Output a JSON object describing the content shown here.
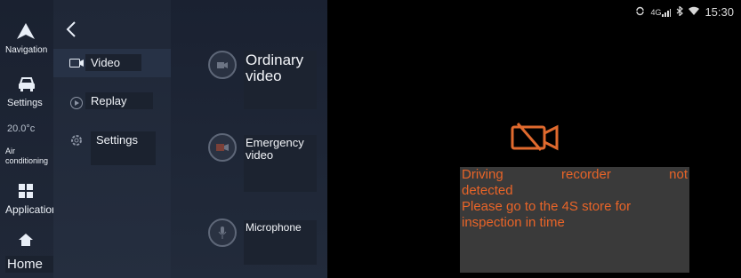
{
  "dock": {
    "items": [
      {
        "label": "Navigation",
        "icon": "navigation-arrow-icon"
      },
      {
        "label": "Settings",
        "icon": "car-icon"
      },
      {
        "label": "Air conditioning",
        "temperature": "20.0°c",
        "icon": "temperature-display"
      },
      {
        "label": "Applications",
        "icon": "grid-icon"
      },
      {
        "label": "Home",
        "icon": "home-icon"
      }
    ]
  },
  "menu": {
    "back_icon": "chevron-left-icon",
    "items": [
      {
        "label": "Video",
        "icon": "video-icon",
        "active": true
      },
      {
        "label": "Replay",
        "icon": "replay-icon",
        "active": false
      },
      {
        "label": "Settings",
        "icon": "gear-icon",
        "active": false
      }
    ]
  },
  "video_panel": {
    "ordinary": {
      "label": "Ordinary video",
      "icon": "video-icon"
    },
    "emergency": {
      "label": "Emergency video",
      "icon": "emergency-video-icon"
    },
    "microphone": {
      "label": "Microphone",
      "icon": "microphone-icon"
    }
  },
  "status_bar": {
    "time": "15:30",
    "signal": "4G",
    "icons": [
      "sync-icon",
      "signal-icon",
      "bluetooth-icon",
      "wifi-icon"
    ]
  },
  "notice": {
    "line1_words": [
      "Driving",
      "recorder",
      "not"
    ],
    "line2": "detected",
    "line3": "Please go to the 4S store for",
    "line4": "inspection in time",
    "icon": "camera-off-icon",
    "color": "#e86428"
  }
}
